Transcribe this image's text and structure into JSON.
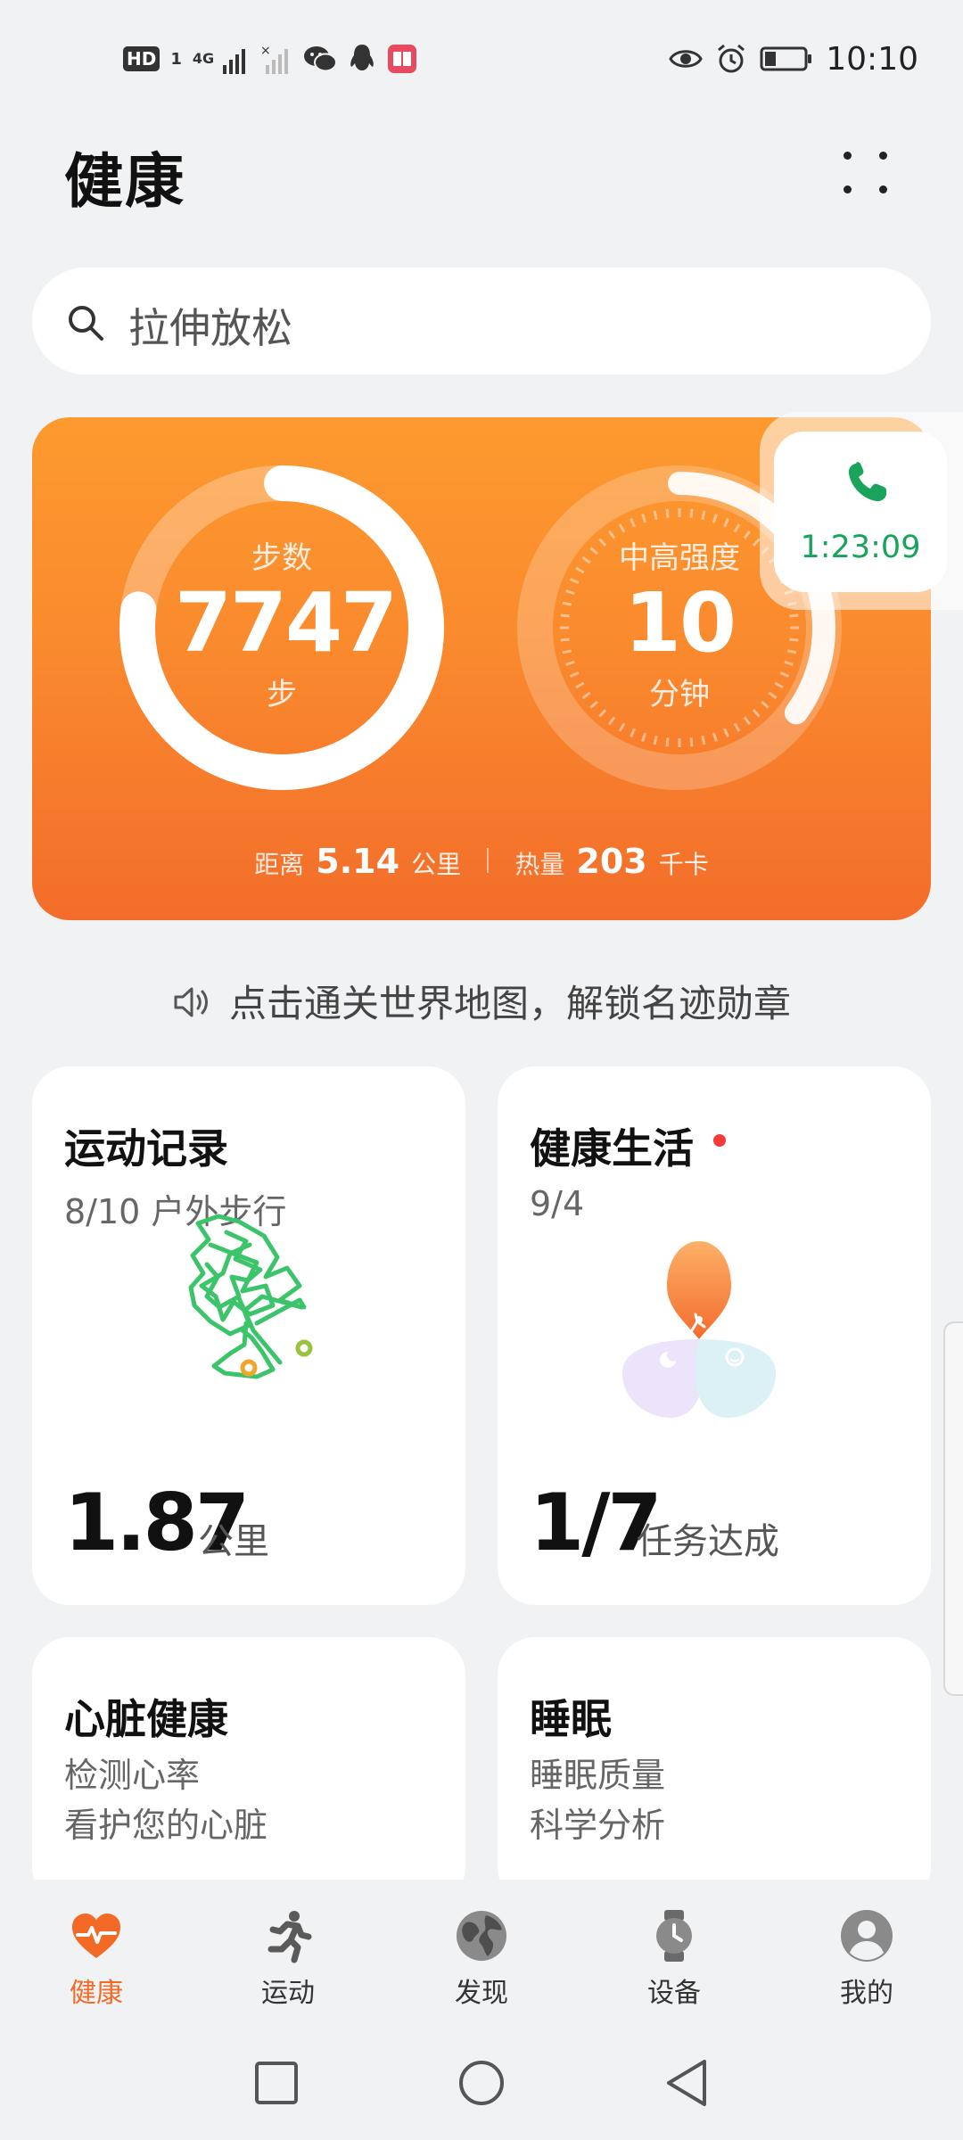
{
  "status_bar": {
    "hd": "HD",
    "sim": "1",
    "network": "4G",
    "time": "10:10",
    "icons": [
      "signal-icon",
      "wechat-icon",
      "qq-icon",
      "book-app-icon",
      "eye-icon",
      "alarm-icon",
      "battery-icon"
    ]
  },
  "header": {
    "title": "健康"
  },
  "search": {
    "placeholder": "拉伸放松"
  },
  "activity": {
    "steps": {
      "label": "步数",
      "value": "7747",
      "unit": "步",
      "progress": 0.77
    },
    "intensity": {
      "label": "中高强度",
      "value": "10",
      "unit": "分钟",
      "progress": 0.35
    },
    "distance": {
      "label": "距离",
      "value": "5.14",
      "unit": "公里"
    },
    "calories": {
      "label": "热量",
      "value": "203",
      "unit": "千卡"
    }
  },
  "call": {
    "duration": "1:23:09"
  },
  "tip": {
    "text": "点击通关世界地图，解锁名迹勋章"
  },
  "cards": {
    "exercise": {
      "title": "运动记录",
      "subtitle": "8/10 户外步行",
      "value": "1.87",
      "unit": "公里"
    },
    "healthy_living": {
      "title": "健康生活",
      "subtitle": "9/4",
      "value": "1/7",
      "unit": "任务达成",
      "has_new": true
    },
    "heart": {
      "title": "心脏健康",
      "line1": "检测心率",
      "line2": "看护您的心脏"
    },
    "sleep": {
      "title": "睡眠",
      "line1": "睡眠质量",
      "line2": "科学分析"
    }
  },
  "nav": {
    "items": [
      {
        "label": "健康",
        "icon": "heart-pulse-icon",
        "active": true
      },
      {
        "label": "运动",
        "icon": "runner-icon",
        "active": false
      },
      {
        "label": "发现",
        "icon": "globe-icon",
        "active": false
      },
      {
        "label": "设备",
        "icon": "watch-icon",
        "active": false
      },
      {
        "label": "我的",
        "icon": "profile-icon",
        "active": false
      }
    ]
  },
  "colors": {
    "accent": "#f36a26",
    "card_top": "#fd9a2f",
    "card_bottom": "#f36d2a",
    "call_green": "#1aa35a",
    "route_green": "#3cc46a",
    "page_bg": "#f1f2f4"
  }
}
